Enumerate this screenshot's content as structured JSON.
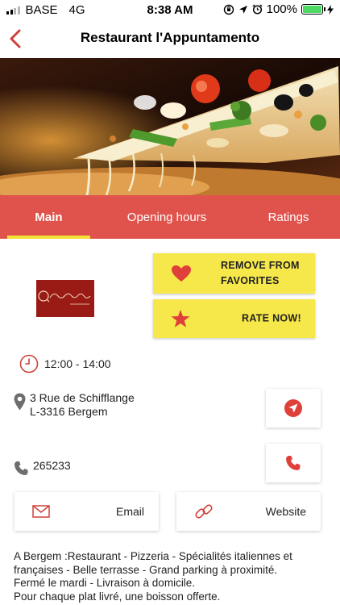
{
  "status_bar": {
    "carrier": "BASE",
    "network": "4G",
    "time": "8:38 AM",
    "battery": "100%"
  },
  "nav": {
    "title": "Restaurant l'Appuntamento",
    "icon": "back-chevron-icon"
  },
  "tabs": [
    {
      "label": "Main",
      "active": true
    },
    {
      "label": "Opening hours",
      "active": false
    },
    {
      "label": "Ratings",
      "active": false
    }
  ],
  "actions": {
    "favorite_label_line1": "REMOVE FROM",
    "favorite_label_line2": "FAVORITES",
    "favorite_icon": "heart-icon",
    "rate_label": "RATE NOW!",
    "rate_icon": "star-icon"
  },
  "info": {
    "hours": "12:00 - 14:00",
    "address_line1": "3 Rue de Schifflange",
    "address_line2": "L-3316 Bergem",
    "phone": "265233"
  },
  "links": {
    "email_label": "Email",
    "website_label": "Website"
  },
  "description": {
    "line1": "A Bergem :Restaurant - Pizzeria - Spécialités italiennes et",
    "line2": "françaises - Belle terrasse - Grand parking à proximité.",
    "line3": "Fermé le mardi - Livraison à domicile.",
    "line4": "Pour chaque plat livré, une boisson offerte."
  },
  "colors": {
    "accent_red": "#e0534d",
    "tab_indicator": "#f3e233",
    "action_yellow": "#f6e84a",
    "icon_red": "#e0403a"
  }
}
